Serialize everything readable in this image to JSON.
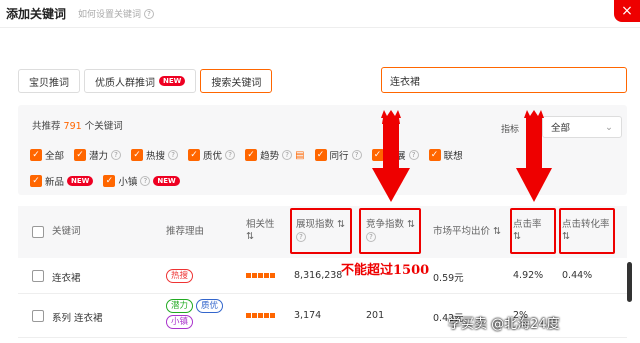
{
  "header": {
    "title": "添加关键词",
    "help_text": "如何设置关键词"
  },
  "tabs": [
    {
      "label": "宝贝推词"
    },
    {
      "label": "优质人群推词",
      "badge": "NEW"
    },
    {
      "label": "搜索关键词"
    }
  ],
  "search": {
    "value": "连衣裙"
  },
  "summary": {
    "prefix": "共推荐",
    "count": "791",
    "suffix": "个关键词"
  },
  "metric": {
    "label": "指标",
    "selected": "全部"
  },
  "filters_row1": [
    {
      "label": "全部",
      "checked": true,
      "help": false
    },
    {
      "label": "潜力",
      "checked": true,
      "help": true
    },
    {
      "label": "热搜",
      "checked": true,
      "help": true
    },
    {
      "label": "质优",
      "checked": true,
      "help": true
    },
    {
      "label": "趋势",
      "checked": true,
      "help": true
    },
    {
      "label": "同行",
      "checked": true,
      "help": true
    },
    {
      "label": "扩展",
      "checked": true,
      "help": true
    },
    {
      "label": "联想",
      "checked": true,
      "help": false
    }
  ],
  "filters_row2": [
    {
      "label": "新品",
      "checked": true,
      "badge": "NEW"
    },
    {
      "label": "小镇",
      "checked": true,
      "badge": "NEW"
    }
  ],
  "columns": {
    "keyword": "关键词",
    "reason": "推荐理由",
    "relevance": "相关性",
    "impressions": "展现指数",
    "competition": "竞争指数",
    "avg_bid": "市场平均出价",
    "ctr": "点击率",
    "cvr": "点击转化率",
    "sort_icon": "⇅"
  },
  "rows": [
    {
      "keyword": "连衣裙",
      "tags": [
        {
          "text": "热搜",
          "color": "red"
        }
      ],
      "impressions": "8,316,238",
      "competition": "",
      "avg_bid": "0.59元",
      "ctr": "4.92%",
      "cvr": "0.44%"
    },
    {
      "keyword": "系列 连衣裙",
      "tags": [
        {
          "text": "潜力",
          "color": "green"
        },
        {
          "text": "质优",
          "color": "blue"
        },
        {
          "text": "小镇",
          "color": "purple"
        }
      ],
      "impressions": "3,174",
      "competition": "201",
      "avg_bid": "0.42元",
      "ctr": "2%",
      "cvr": ""
    }
  ],
  "annotation": {
    "text": "不能超过1500"
  },
  "watermark": {
    "text": "学买卖 @北海24度"
  },
  "colors": {
    "accent": "#ff6600",
    "annotation": "#e00000"
  }
}
